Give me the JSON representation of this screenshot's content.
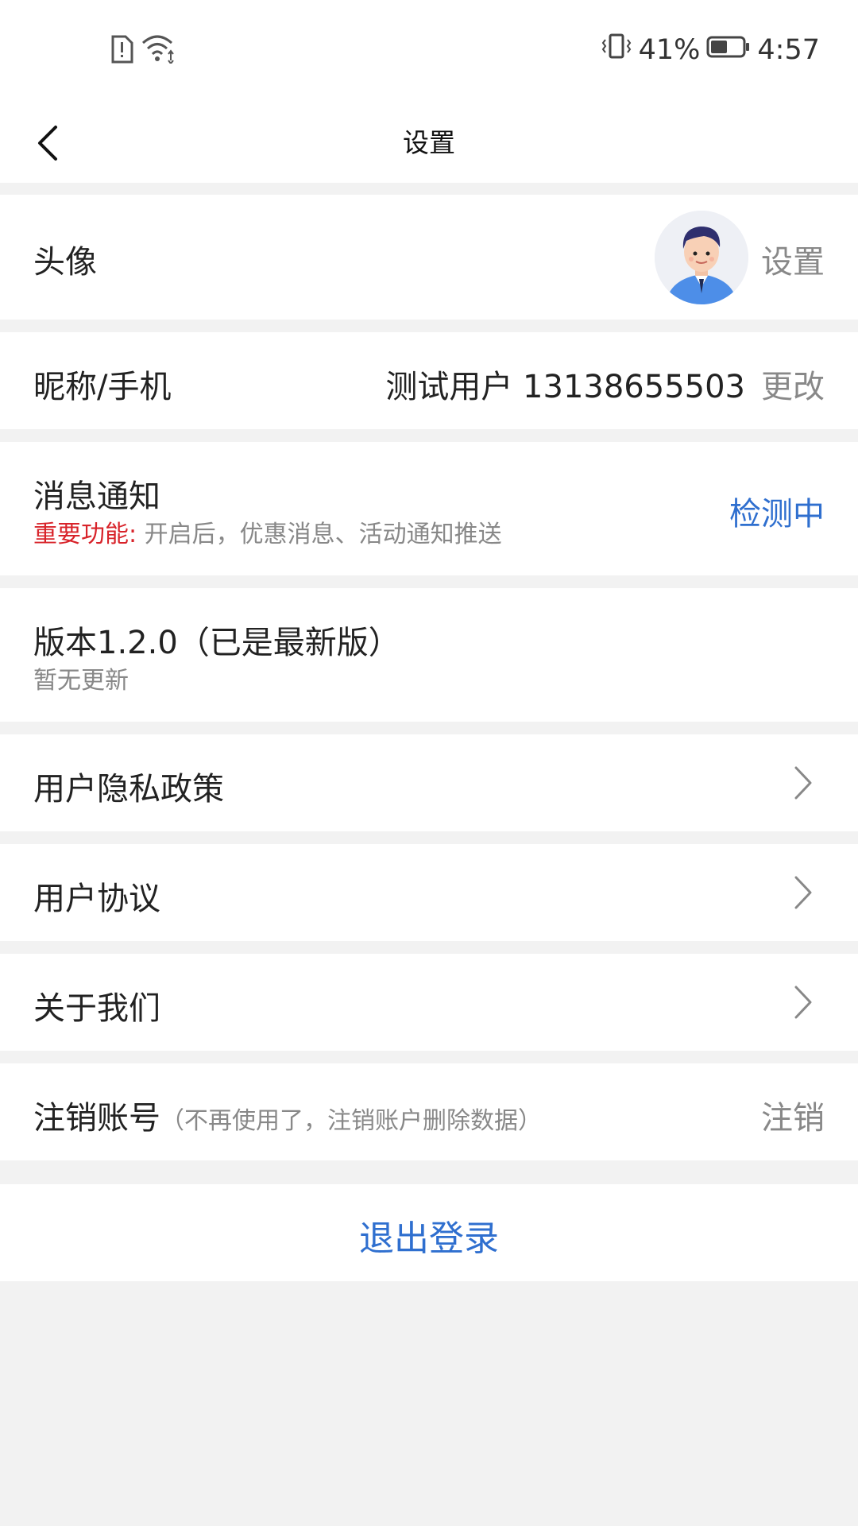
{
  "status_bar": {
    "battery_percent": "41%",
    "time": "4:57",
    "icons": [
      "sim-alert-icon",
      "wifi-icon",
      "vibrate-icon",
      "battery-icon"
    ]
  },
  "nav": {
    "title": "设置"
  },
  "settings": {
    "avatar": {
      "label": "头像",
      "action": "设置"
    },
    "nickname": {
      "label": "昵称/手机",
      "value": "测试用户 13138655503",
      "action": "更改"
    },
    "notification": {
      "label": "消息通知",
      "important_prefix": "重要功能:",
      "description": " 开启后，优惠消息、活动通知推送",
      "status": "检测中"
    },
    "version": {
      "label": "版本1.2.0（已是最新版）",
      "sub": "暂无更新"
    },
    "privacy": {
      "label": "用户隐私政策"
    },
    "agreement": {
      "label": "用户协议"
    },
    "about": {
      "label": "关于我们"
    },
    "cancel_account": {
      "label": "注销账号",
      "hint": "（不再使用了，注销账户删除数据）",
      "action": "注销"
    }
  },
  "logout": {
    "label": "退出登录"
  },
  "colors": {
    "accent": "#2f6fcf",
    "important": "#d8232a",
    "background": "#f2f2f2"
  }
}
